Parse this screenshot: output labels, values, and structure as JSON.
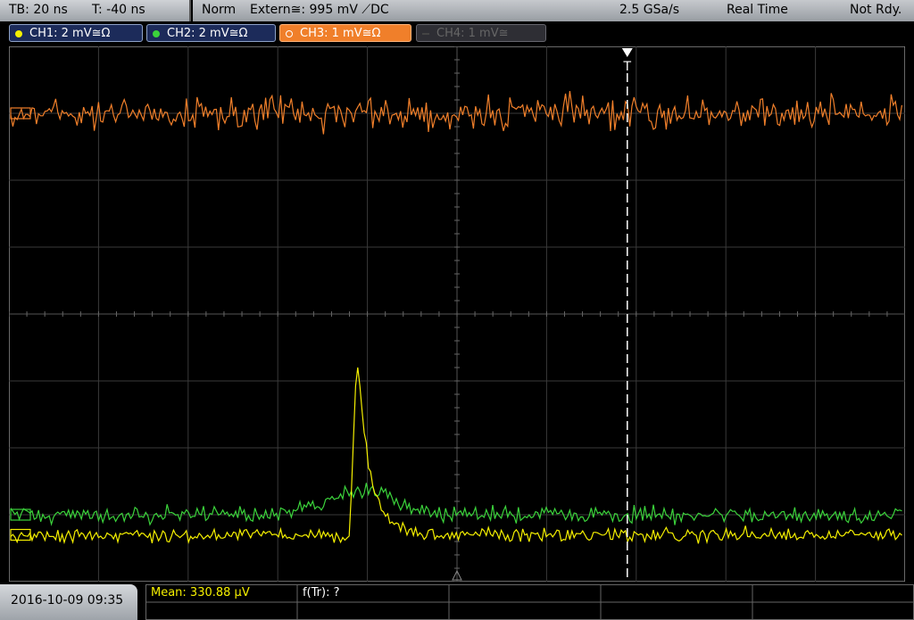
{
  "topbar": {
    "timebase": "TB: 20 ns",
    "trigger_time": "T: -40 ns",
    "mode": "Norm",
    "trigger_source": "Extern≅: 995 mV ⟋DC",
    "sample_rate": "2.5 GSa/s",
    "acq_mode": "Real Time",
    "status": "Not Rdy."
  },
  "channels": [
    {
      "label": "CH1: 2 mV≅Ω",
      "color": "#f5f000"
    },
    {
      "label": "CH2: 2 mV≅Ω",
      "color": "#3bd33b"
    },
    {
      "label": "CH3: 1 mV≅Ω",
      "color": "#f07f2a"
    },
    {
      "label": "CH4: 1 mV≅",
      "color": "#666666"
    }
  ],
  "markers": {
    "trigger_marker": "T"
  },
  "footer": {
    "datetime": "2016-10-09 09:35",
    "mean": "Mean: 330.88 µV",
    "ftr": "f(Tr): ?"
  },
  "chart_data": {
    "type": "line",
    "grid": true,
    "x_divisions": 10,
    "y_divisions": 8,
    "trigger_position_div": 7.0,
    "series": [
      {
        "name": "CH3",
        "color": "#f07f2a",
        "baseline_div": 1.0,
        "noise_div": 0.35,
        "pulse_div": 0
      },
      {
        "name": "CH2",
        "color": "#3bd33b",
        "baseline_div": 7.0,
        "noise_div": 0.18,
        "pulse_div": 0.35
      },
      {
        "name": "CH1",
        "color": "#f5f000",
        "baseline_div": 7.3,
        "noise_div": 0.15,
        "pulse_div": 2.75
      }
    ]
  }
}
